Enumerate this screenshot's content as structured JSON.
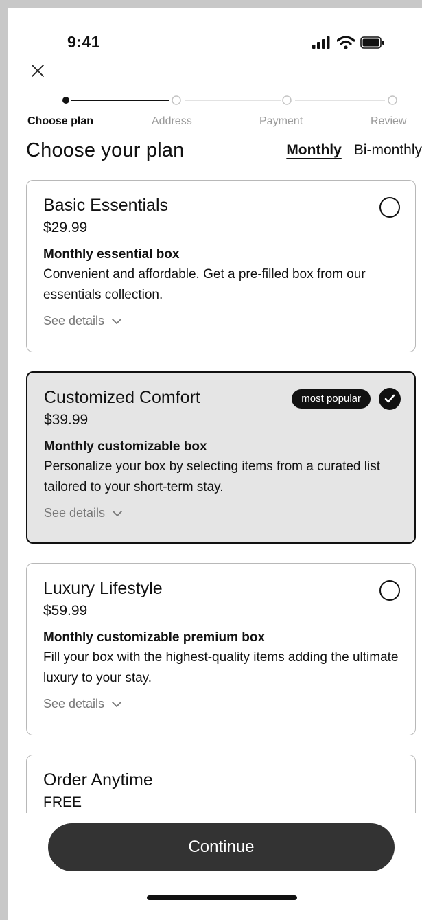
{
  "status_bar": {
    "time": "9:41"
  },
  "stepper": {
    "steps": [
      {
        "label": "Choose plan",
        "active": true
      },
      {
        "label": "Address",
        "active": false
      },
      {
        "label": "Payment",
        "active": false
      },
      {
        "label": "Review",
        "active": false
      }
    ]
  },
  "header": {
    "title": "Choose your plan",
    "frequency_options": [
      "Monthly",
      "Bi-monthly"
    ],
    "selected_frequency": "Monthly"
  },
  "plans": [
    {
      "name": "Basic Essentials",
      "price": "$29.99",
      "subtitle": "Monthly essential box",
      "description": "Convenient and affordable. Get a pre-filled box from our essentials collection.",
      "details_label": "See details",
      "selected": false
    },
    {
      "name": "Customized Comfort",
      "price": "$39.99",
      "badge": "most popular",
      "subtitle": "Monthly customizable box",
      "description": "Personalize your box by selecting items from a curated list tailored to your short-term stay.",
      "details_label": "See details",
      "selected": true
    },
    {
      "name": "Luxury Lifestyle",
      "price": "$59.99",
      "subtitle": "Monthly customizable premium box",
      "description": "Fill your box with the highest-quality items adding the ultimate luxury to your stay.",
      "details_label": "See details",
      "selected": false
    },
    {
      "name": "Order Anytime",
      "price": "FREE",
      "selected": false
    }
  ],
  "footer": {
    "continue_label": "Continue"
  },
  "icons": {
    "signal": "cellular-signal-icon",
    "wifi": "wifi-icon",
    "battery": "battery-icon",
    "close": "close-icon",
    "chevron": "chevron-down-icon",
    "check": "checkmark-icon"
  },
  "colors": {
    "accent": "#111111",
    "selected_card_bg": "#e5e5e5",
    "button_bg": "#333333",
    "muted_text": "#777777"
  }
}
